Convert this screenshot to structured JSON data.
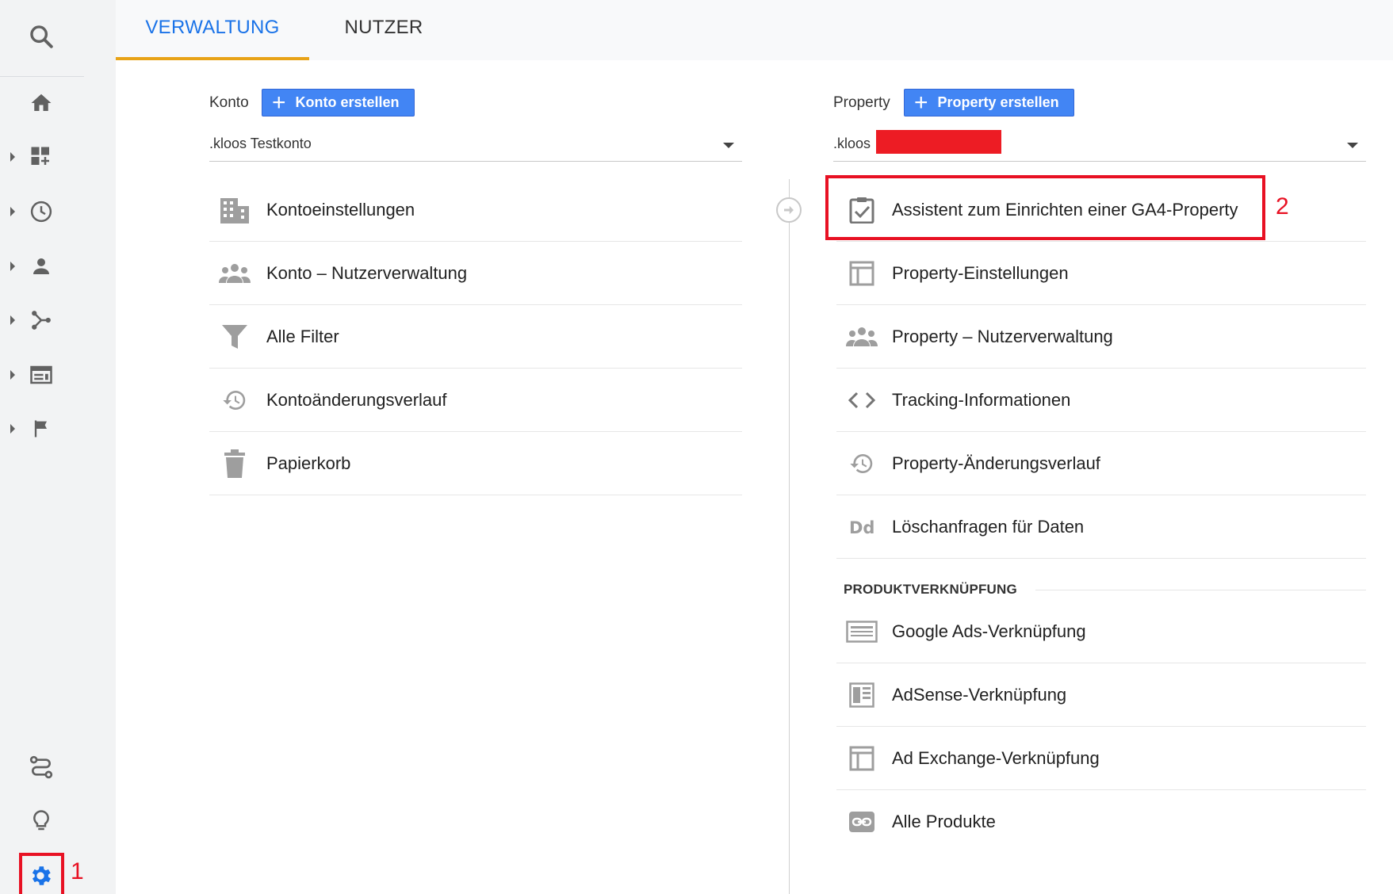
{
  "tabs": {
    "admin": "VERWALTUNG",
    "user": "NUTZER"
  },
  "account": {
    "label": "Konto",
    "create_button": "Konto erstellen",
    "selected": ".kloos Testkonto",
    "items": [
      {
        "label": "Kontoeinstellungen",
        "icon": "building-icon"
      },
      {
        "label": "Konto – Nutzerverwaltung",
        "icon": "people-icon"
      },
      {
        "label": "Alle Filter",
        "icon": "filter-icon"
      },
      {
        "label": "Kontoänderungsverlauf",
        "icon": "history-icon"
      },
      {
        "label": "Papierkorb",
        "icon": "trash-icon"
      }
    ]
  },
  "property": {
    "label": "Property",
    "create_button": "Property erstellen",
    "selected": ".kloos",
    "items": [
      {
        "label": "Assistent zum Einrichten einer GA4-Property",
        "icon": "clipboard-check-icon"
      },
      {
        "label": "Property-Einstellungen",
        "icon": "layout-icon"
      },
      {
        "label": "Property – Nutzerverwaltung",
        "icon": "people-icon"
      },
      {
        "label": "Tracking-Informationen",
        "icon": "code-icon"
      },
      {
        "label": "Property-Änderungsverlauf",
        "icon": "history-icon"
      },
      {
        "label": "Löschanfragen für Daten",
        "icon": "dd-icon"
      }
    ],
    "section_title": "PRODUKTVERKNÜPFUNG",
    "product_links": [
      {
        "label": "Google Ads-Verknüpfung",
        "icon": "ads-icon"
      },
      {
        "label": "AdSense-Verknüpfung",
        "icon": "adsense-icon"
      },
      {
        "label": "Ad Exchange-Verknüpfung",
        "icon": "layout-icon"
      },
      {
        "label": "Alle Produkte",
        "icon": "link-icon"
      }
    ]
  },
  "sidebar": {
    "icons": [
      "search-icon",
      "home-icon",
      "dashboard-icon",
      "clock-icon",
      "person-icon",
      "acquisition-icon",
      "behavior-icon",
      "flag-icon",
      "route-icon",
      "lightbulb-icon",
      "gear-icon"
    ]
  },
  "annotations": {
    "one": "1",
    "two": "2"
  },
  "colors": {
    "accent_blue": "#1a73e8",
    "button_blue": "#4285f4",
    "tab_underline": "#e8a317",
    "highlight_red": "#e81123"
  }
}
